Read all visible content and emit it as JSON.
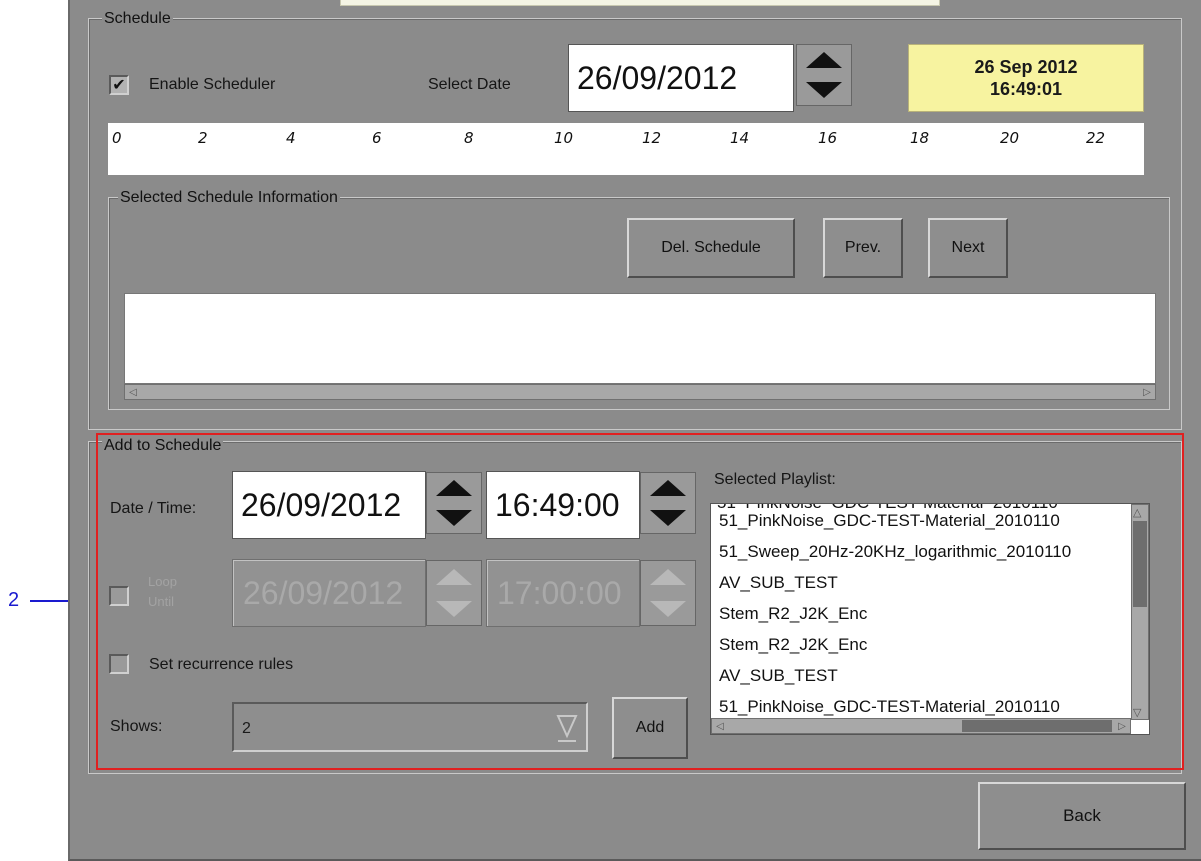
{
  "schedule": {
    "legend": "Schedule",
    "enable_scheduler_label": "Enable Scheduler",
    "enable_scheduler_checked": true,
    "select_date_label": "Select Date",
    "select_date_value": "26/09/2012",
    "clock_date": "26 Sep 2012",
    "clock_time": "16:49:01",
    "timeline_hours": [
      "0",
      "2",
      "4",
      "6",
      "8",
      "10",
      "12",
      "14",
      "16",
      "18",
      "20",
      "22"
    ]
  },
  "selected_info": {
    "legend": "Selected Schedule Information",
    "del_label": "Del. Schedule",
    "prev_label": "Prev.",
    "next_label": "Next"
  },
  "add": {
    "legend": "Add to Schedule",
    "date_time_label": "Date / Time:",
    "date_value": "26/09/2012",
    "time_value": "16:49:00",
    "loop_label_1": "Loop",
    "loop_label_2": "Until",
    "loop_date_value": "26/09/2012",
    "loop_time_value": "17:00:00",
    "recurrence_label": "Set recurrence rules",
    "shows_label": "Shows:",
    "shows_value": "2",
    "add_label": "Add",
    "playlist_label": "Selected Playlist:",
    "playlist_items": [
      "51_PinkNoise_GDC-TEST-Material_2010110",
      "51_Sweep_20Hz-20KHz_logarithmic_2010110",
      "AV_SUB_TEST",
      "Stem_R2_J2K_Enc",
      "Stem_R2_J2K_Enc",
      "AV_SUB_TEST",
      "51_PinkNoise_GDC-TEST-Material_2010110"
    ]
  },
  "back_label": "Back",
  "callout": "2",
  "colors": {
    "panel": "#8b8b8b",
    "clock_bg": "#f7f3a0",
    "highlight": "#e02020",
    "callout": "#1a1acf"
  }
}
